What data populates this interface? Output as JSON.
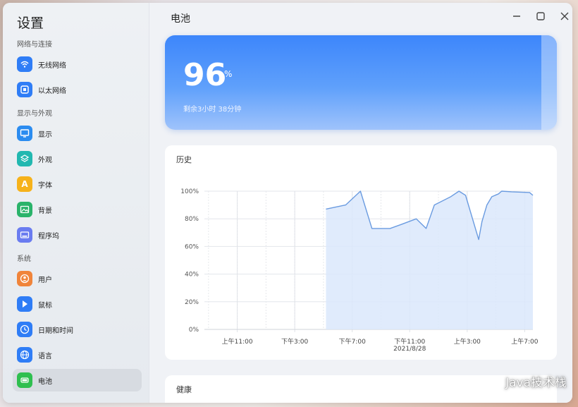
{
  "app": {
    "title": "设置"
  },
  "sidebar": {
    "groups": [
      {
        "title": "网络与连接",
        "items": [
          {
            "label": "无线网络",
            "icon": "wifi-icon",
            "color": "#2f7df6"
          },
          {
            "label": "以太网络",
            "icon": "ethernet-icon",
            "color": "#2f7df6"
          }
        ]
      },
      {
        "title": "显示与外观",
        "items": [
          {
            "label": "显示",
            "icon": "monitor-icon",
            "color": "#2b8cf0"
          },
          {
            "label": "外观",
            "icon": "layers-icon",
            "color": "#22b8b0"
          },
          {
            "label": "字体",
            "icon": "font-icon",
            "color": "#f6b21b"
          },
          {
            "label": "背景",
            "icon": "image-icon",
            "color": "#2ab36a"
          },
          {
            "label": "程序坞",
            "icon": "dock-icon",
            "color": "#6a7cf0"
          }
        ]
      },
      {
        "title": "系统",
        "items": [
          {
            "label": "用户",
            "icon": "user-icon",
            "color": "#f0843a"
          },
          {
            "label": "鼠标",
            "icon": "cursor-icon",
            "color": "#2f7df6"
          },
          {
            "label": "日期和时间",
            "icon": "clock-icon",
            "color": "#2f7df6"
          },
          {
            "label": "语言",
            "icon": "globe-icon",
            "color": "#2f7df6"
          },
          {
            "label": "电池",
            "icon": "battery-icon",
            "color": "#2fbf4f",
            "active": true
          }
        ]
      }
    ]
  },
  "window_controls": {
    "minimize": "—",
    "maximize": "□",
    "close": "✕"
  },
  "main": {
    "title": "电池",
    "battery": {
      "percent": "96",
      "unit": "%",
      "remaining": "剩余3小时 38分钟",
      "level": 0.96
    },
    "history": {
      "heading": "历史"
    },
    "health": {
      "heading": "健康"
    }
  },
  "watermark": {
    "text": "Java技术栈"
  },
  "chart_data": {
    "type": "area",
    "title": "",
    "xlabel": "",
    "ylabel": "",
    "ylim": [
      0,
      100
    ],
    "yticks": [
      "0%",
      "20%",
      "40%",
      "60%",
      "80%",
      "100%"
    ],
    "xticks": [
      {
        "label": "上午11:00",
        "sub": "",
        "pos": 0.1
      },
      {
        "label": "下午3:00",
        "sub": "",
        "pos": 0.275
      },
      {
        "label": "下午7:00",
        "sub": "",
        "pos": 0.45
      },
      {
        "label": "下午11:00",
        "sub": "2021/8/28",
        "pos": 0.625
      },
      {
        "label": "上午3:00",
        "sub": "",
        "pos": 0.8
      },
      {
        "label": "上午7:00",
        "sub": "",
        "pos": 0.975
      }
    ],
    "grid": true,
    "color": "#6a9be0",
    "fill": "#dbe7fb",
    "series": [
      {
        "points": [
          [
            0.37,
            87
          ],
          [
            0.43,
            90
          ],
          [
            0.475,
            100
          ],
          [
            0.51,
            73
          ],
          [
            0.565,
            73
          ],
          [
            0.6,
            76
          ],
          [
            0.645,
            80
          ],
          [
            0.675,
            73
          ],
          [
            0.7,
            90
          ],
          [
            0.75,
            96
          ],
          [
            0.775,
            100
          ],
          [
            0.795,
            97
          ],
          [
            0.835,
            65
          ],
          [
            0.845,
            78
          ],
          [
            0.86,
            90
          ],
          [
            0.875,
            96
          ],
          [
            0.895,
            98
          ],
          [
            0.905,
            100
          ],
          [
            0.935,
            99.5
          ],
          [
            0.99,
            99
          ],
          [
            1.0,
            97
          ]
        ]
      }
    ]
  }
}
